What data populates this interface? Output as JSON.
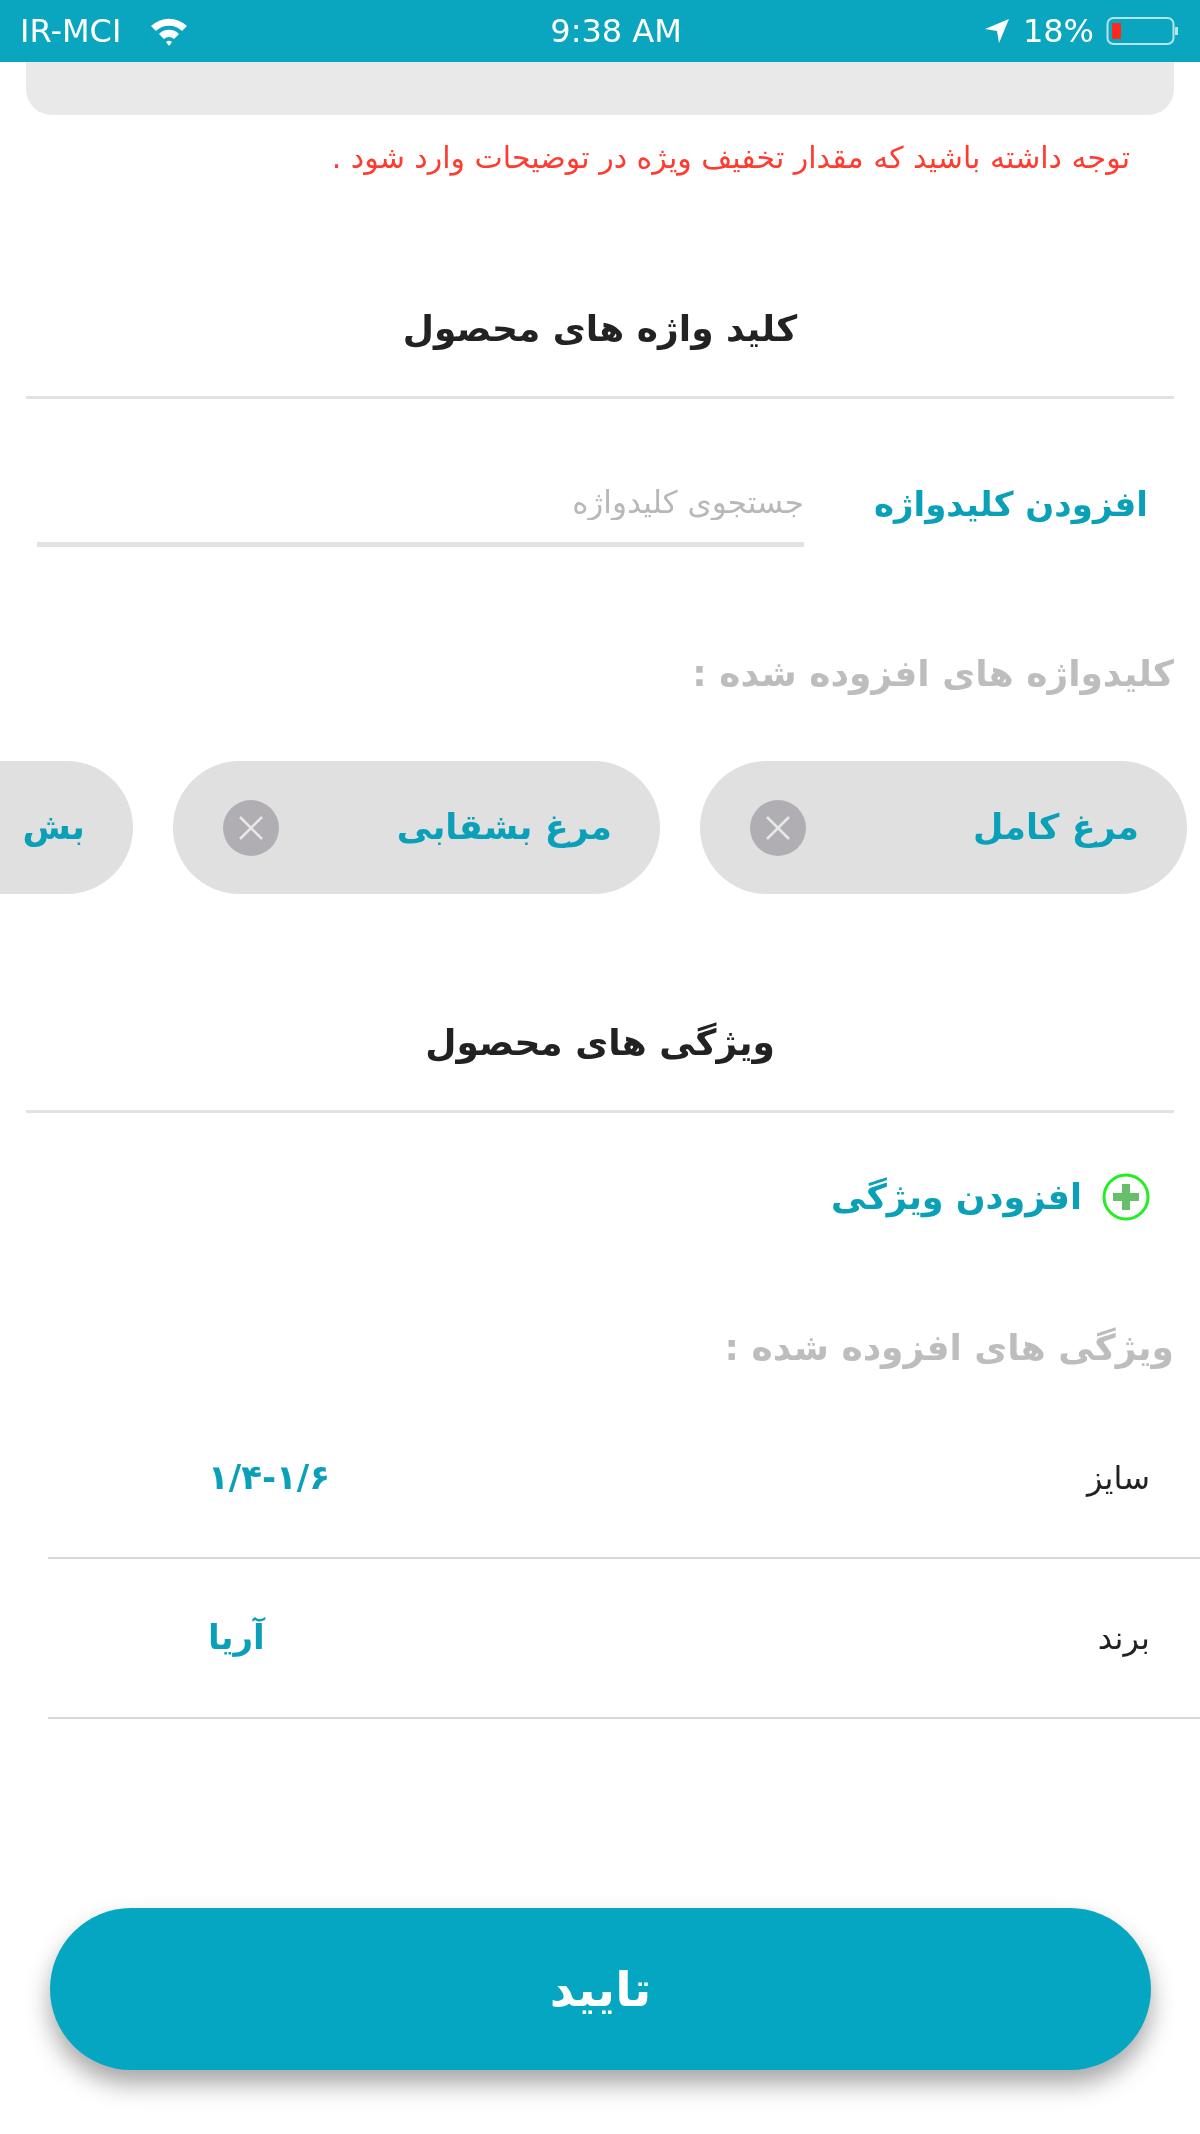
{
  "status_bar": {
    "carrier": "IR-MCI",
    "time": "9:38 AM",
    "battery": "18%"
  },
  "note": "توجه داشته باشید که مقدار تخفیف ویژه در توضیحات وارد شود .",
  "keywords": {
    "title": "کلید واژه های محصول",
    "add_link": "افزودن کلیدواژه",
    "search": {
      "placeholder": "جستجوی کلیدواژه"
    },
    "added_label": "کلیدواژه های افزوده شده :",
    "chips": [
      {
        "label": "مرغ کامل",
        "kind": "full"
      },
      {
        "label": "مرغ بشقابی",
        "kind": "full"
      },
      {
        "label": "بش",
        "kind": "partial"
      }
    ]
  },
  "features": {
    "title": "ویژگی های محصول",
    "add_button": "افزودن ویژگی",
    "added_label": "ویژگی های افزوده شده :",
    "rows": [
      {
        "name": "سایز",
        "value": "۱/۴-۱/۶"
      },
      {
        "name": "برند",
        "value": "آریا"
      }
    ]
  },
  "confirm_button": "تایید"
}
